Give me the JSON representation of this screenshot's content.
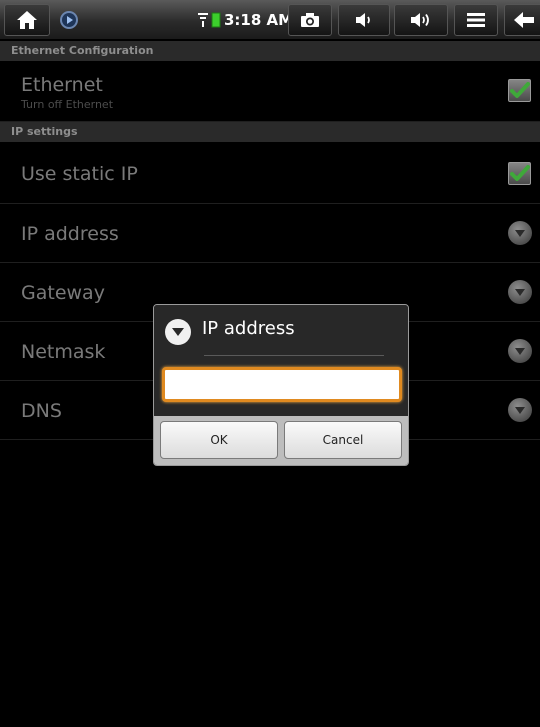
{
  "status_bar": {
    "time": "3:18 AM",
    "icons": [
      "home-icon",
      "play-icon",
      "wifi-icon",
      "battery-icon",
      "camera-icon",
      "volume-down-icon",
      "volume-up-icon",
      "menu-icon",
      "back-icon"
    ]
  },
  "sections": {
    "ethernet_config": "Ethernet Configuration",
    "ip_settings": "IP settings"
  },
  "prefs": {
    "ethernet": {
      "title": "Ethernet",
      "summary": "Turn off Ethernet",
      "checked": true
    },
    "use_static_ip": {
      "title": "Use static IP",
      "checked": true
    },
    "ip_address": {
      "title": "IP address"
    },
    "gateway": {
      "title": "Gateway"
    },
    "netmask": {
      "title": "Netmask"
    },
    "dns": {
      "title": "DNS"
    }
  },
  "dialog": {
    "title": "IP address",
    "input_value": "",
    "ok_label": "OK",
    "cancel_label": "Cancel"
  },
  "colors": {
    "check_green": "#3fa93a",
    "input_focus": "#e08a20"
  }
}
